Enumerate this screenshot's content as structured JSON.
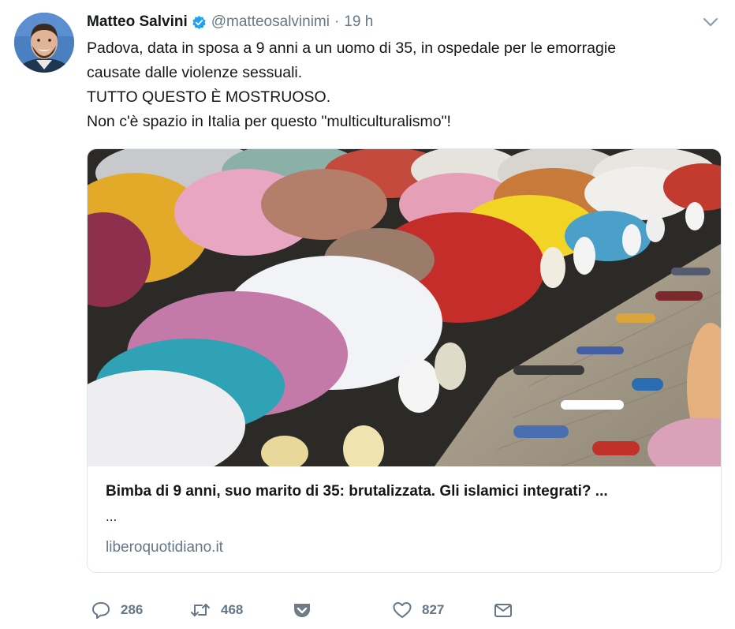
{
  "tweet": {
    "author_name": "Matteo Salvini",
    "author_handle": "@matteosalvinimi",
    "separator": "·",
    "time": "19 h",
    "text_lines": [
      "Padova, data in sposa a 9 anni a un uomo di 35, in ospedale per le emorragie",
      "causate dalle violenze sessuali.",
      "TUTTO QUESTO È MOSTRUOSO.",
      "Non c'è spazio in Italia per questo \"multiculturalismo\"!"
    ]
  },
  "card": {
    "title": "Bimba di 9 anni, suo marito di 35: brutalizzata. Gli islamici integrati? ...",
    "ellipsis": "...",
    "domain": "liberoquotidiano.it"
  },
  "actions": {
    "reply_count": "286",
    "retweet_count": "468",
    "like_count": "827"
  },
  "icons": {
    "verified": "verified-badge-icon",
    "caret": "chevron-down-icon",
    "reply": "reply-icon",
    "retweet": "retweet-icon",
    "pocket": "pocket-icon",
    "like": "heart-icon",
    "message": "envelope-icon"
  },
  "colors": {
    "text": "#14171a",
    "secondary": "#657786",
    "verified": "#1da1f2",
    "pocket": "#6f7b86",
    "border": "#e1e8ed"
  }
}
